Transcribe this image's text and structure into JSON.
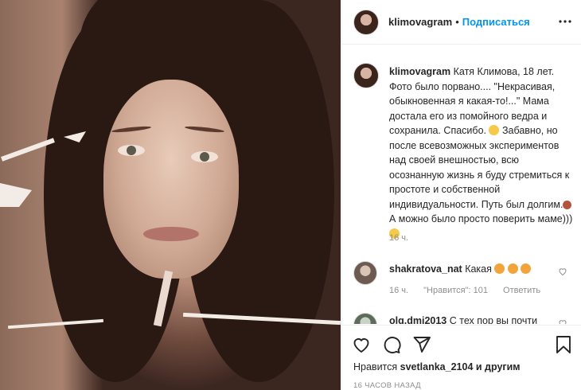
{
  "post": {
    "username": "klimovagram",
    "separator": "•",
    "follow_label": "Подписаться"
  },
  "caption": {
    "username": "klimovagram",
    "text_1": "Катя Климова, 18 лет. Фото было порвано.... \"Некрасивая, обыкновенная я какая-то!...\" Мама достала его из помойного ведра и сохранила. Спасибо.",
    "text_2": "Забавно, но после всевозможных экспериментов над своей внешностью, всю осознанную жизнь я буду стремиться к простоте и собственной индивидуальности. Путь был долгим.",
    "text_3": "А можно было просто поверить маме)))",
    "time": "16 ч."
  },
  "comments": [
    {
      "username": "shakratova_nat",
      "text": "Какая",
      "time": "16 ч.",
      "likes": "\"Нравится\": 101",
      "reply": "Ответить"
    },
    {
      "username": "olg.dmi2013",
      "text": "С тех пор вы почти"
    }
  ],
  "footer": {
    "likes_prefix": "Нравится",
    "likes_user": "svetlanka_2104",
    "likes_suffix": "и другим",
    "time": "16 ЧАСОВ НАЗАД"
  },
  "colors": {
    "accent": "#0095f6",
    "muted": "#8e8e8e",
    "border": "#efefef"
  },
  "icons": [
    "more-icon",
    "heart-icon",
    "comment-icon",
    "share-icon",
    "bookmark-icon",
    "heart-small-icon"
  ]
}
